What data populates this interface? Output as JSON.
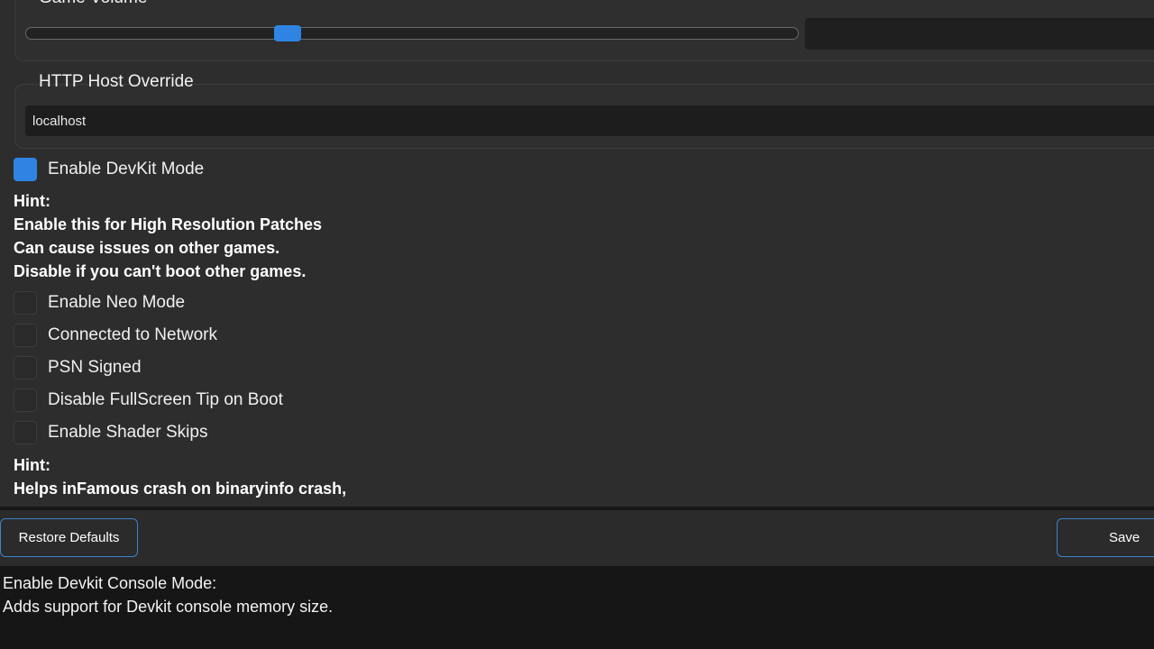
{
  "volume_group": {
    "title": "Game Volume",
    "slider_value_percent": 34
  },
  "http_group": {
    "title": "HTTP Host Override",
    "value": "localhost"
  },
  "checkboxes": [
    {
      "label": "Enable DevKit Mode",
      "checked": true
    },
    {
      "label": "Enable Neo Mode",
      "checked": false
    },
    {
      "label": "Connected to Network",
      "checked": false
    },
    {
      "label": "PSN Signed",
      "checked": false
    },
    {
      "label": "Disable FullScreen Tip on Boot",
      "checked": false
    },
    {
      "label": "Enable Shader Skips",
      "checked": false
    }
  ],
  "hint_devkit": {
    "title": "Hint:",
    "lines": [
      "Enable this for High Resolution Patches",
      "Can cause issues on other games.",
      "Disable if you can't boot other games."
    ]
  },
  "hint_shader": {
    "title": "Hint:",
    "lines": [
      "Helps inFamous crash on binaryinfo crash,"
    ]
  },
  "buttons": {
    "restore_defaults": "Restore Defaults",
    "save": "Save"
  },
  "description": {
    "title": "Enable Devkit Console Mode:",
    "body": "Adds support for Devkit console memory size."
  },
  "colors": {
    "accent": "#2f84e3",
    "panel_bg": "#2d2d2d",
    "window_bg": "#161616"
  }
}
